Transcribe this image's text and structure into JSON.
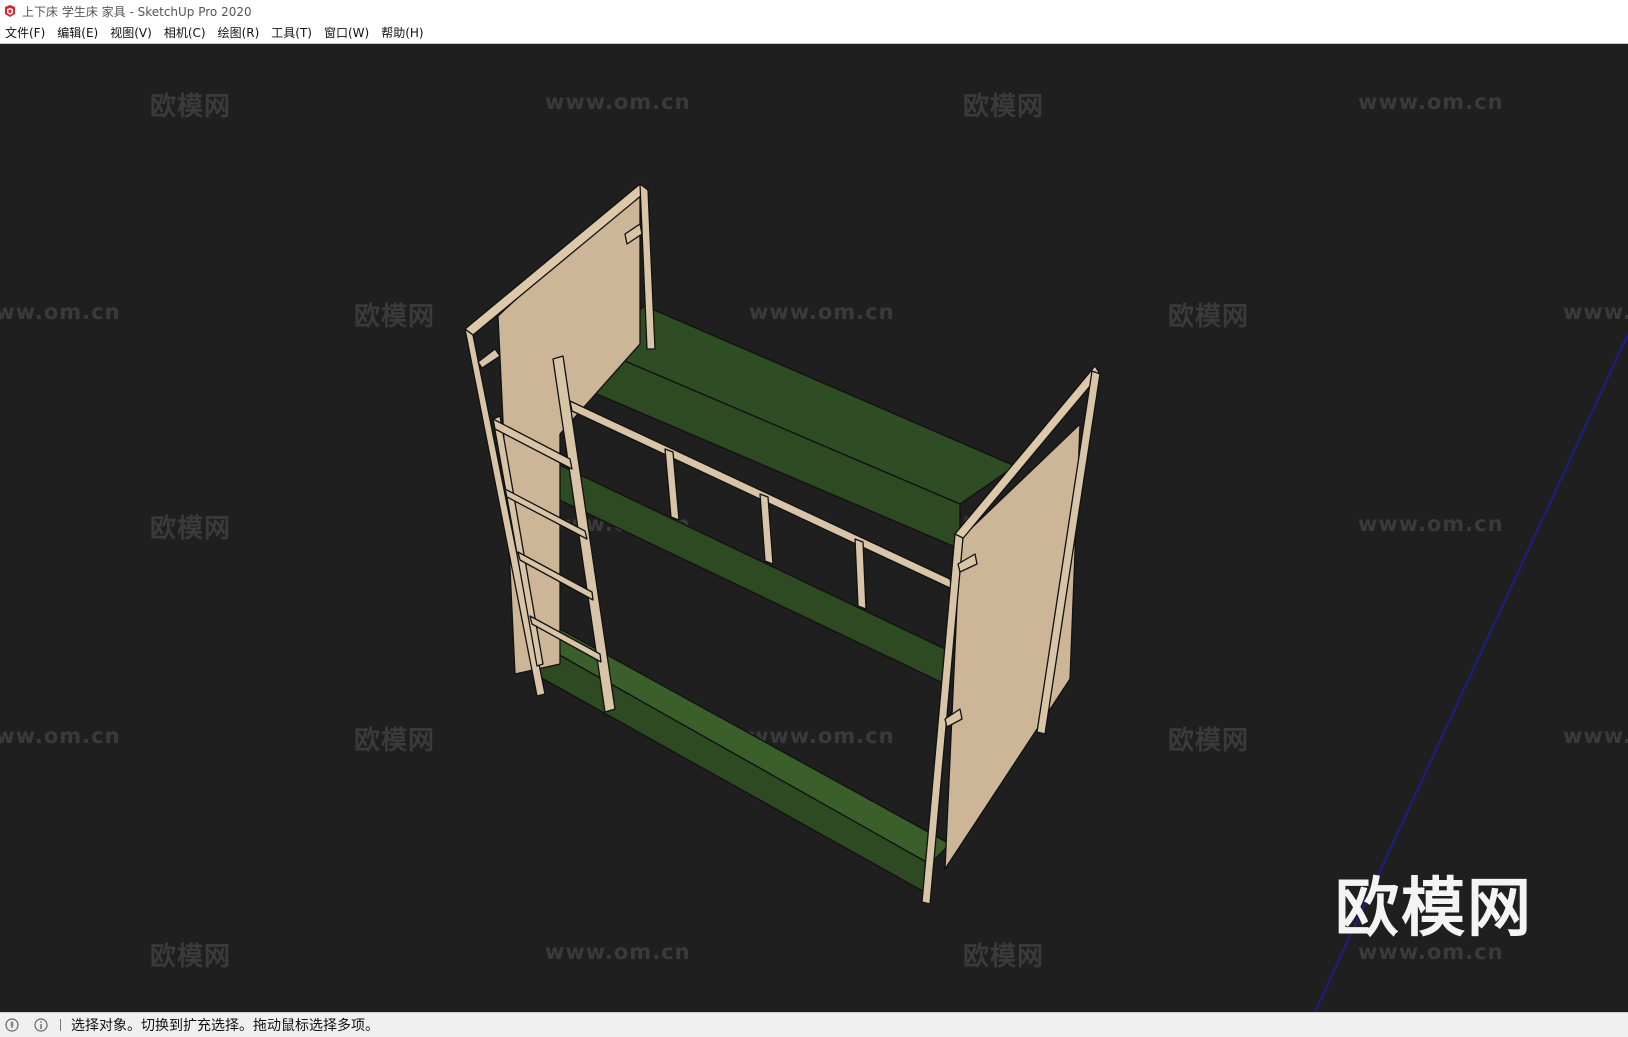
{
  "window": {
    "title": "上下床 学生床 家具 - SketchUp Pro 2020"
  },
  "menu": {
    "items": [
      {
        "label": "文件(F)"
      },
      {
        "label": "编辑(E)"
      },
      {
        "label": "视图(V)"
      },
      {
        "label": "相机(C)"
      },
      {
        "label": "绘图(R)"
      },
      {
        "label": "工具(T)"
      },
      {
        "label": "窗口(W)"
      },
      {
        "label": "帮助(H)"
      }
    ]
  },
  "watermarks": {
    "cn": "欧模网",
    "url": "www.om.cn",
    "big": "欧模网"
  },
  "viewport": {
    "model": "bunk-bed",
    "colors": {
      "background": "#1f1f1f",
      "wood": "#d8c4a6",
      "wood_dark": "#b9a184",
      "green": "#2d4a22",
      "green_light": "#3a5f2b",
      "axis_blue": "#1d1d8a"
    }
  },
  "status": {
    "icons": [
      "geo-location-icon",
      "info-icon"
    ],
    "message": "选择对象。切换到扩充选择。拖动鼠标选择多项。"
  }
}
